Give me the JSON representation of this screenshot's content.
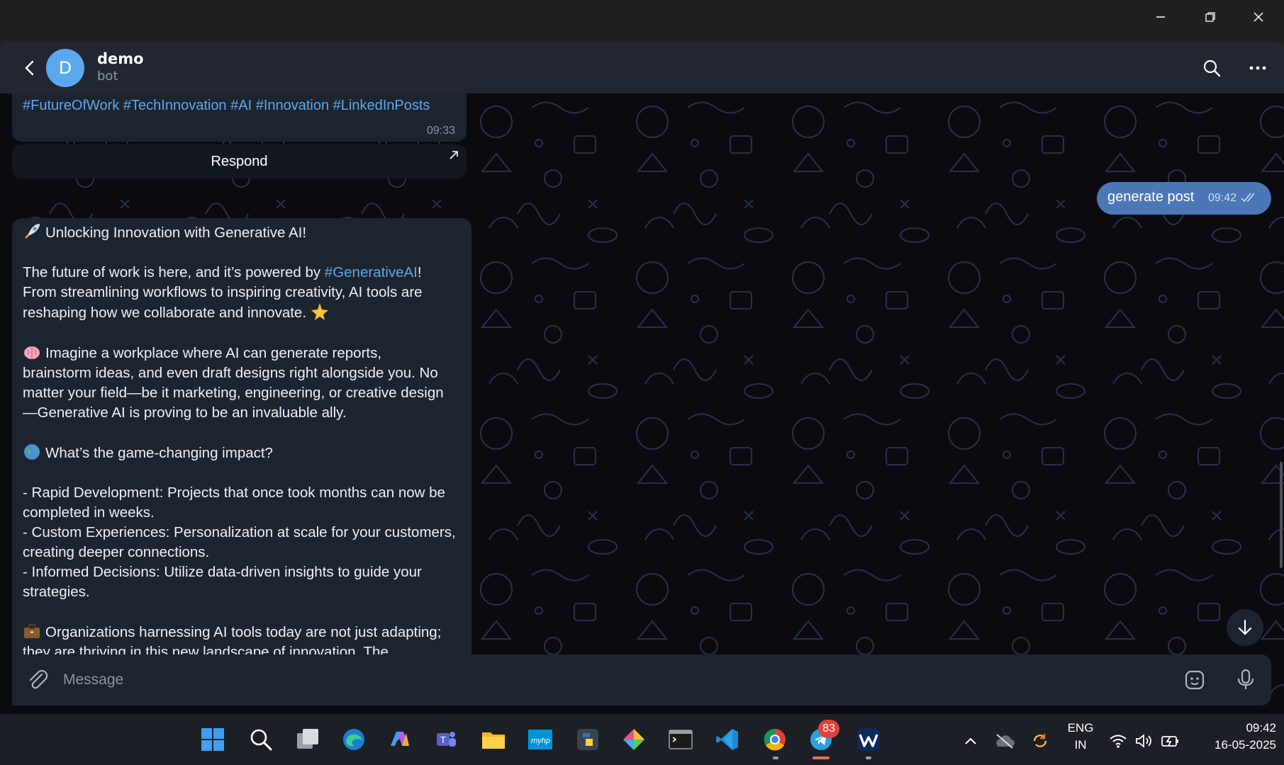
{
  "window": {
    "controls": [
      "minimize-icon",
      "restore-icon",
      "close-icon"
    ]
  },
  "header": {
    "avatar_letter": "D",
    "name": "demo",
    "status": "bot",
    "avatar_color": "#5aa8f0"
  },
  "messages": {
    "previous": {
      "hashtags": "#FutureOfWork #TechInnovation #AI #Innovation #LinkedInPosts",
      "time": "09:33",
      "respond_label": "Respond"
    },
    "outgoing": {
      "text": "generate post",
      "time": "09:42"
    },
    "post": {
      "headline": "Unlocking Innovation with Generative AI!",
      "p1_before": "The future of work is here, and it’s powered by ",
      "p1_link": "#GenerativeAI",
      "p1_after": "!",
      "p1_l2": "From streamlining workflows to inspiring creativity, AI tools are",
      "p1_l3": "reshaping how we collaborate and innovate.",
      "p2_l1": "Imagine a workplace where AI can generate reports,",
      "p2_l2": "brainstorm ideas, and even draft designs right alongside you. No",
      "p2_l3": "matter your field—be it marketing, engineering, or creative design",
      "p2_l4": "—Generative AI is proving to be an invaluable ally.",
      "p3": "What’s the game-changing impact?",
      "b1_l1": "- Rapid Development: Projects that once took months can now be",
      "b1_l2": "completed in weeks.",
      "b2_l1": "- Custom Experiences: Personalization at scale for your customers,",
      "b2_l2": "creating deeper connections.",
      "b3_l1": "- Informed Decisions: Utilize data-driven insights to guide your",
      "b3_l2": "strategies.",
      "p5_l1": "Organizations harnessing AI tools today are not just adapting;",
      "p5_l2": "they are thriving in this new landscape of innovation. The"
    }
  },
  "composer": {
    "placeholder": "Message"
  },
  "taskbar": {
    "telegram_badge": "83",
    "lang_line1": "ENG",
    "lang_line2": "IN",
    "time": "09:42",
    "date": "16-05-2025"
  },
  "colors": {
    "accent": "#4b77b6",
    "link": "#5fa8e8",
    "bubble": "#1c2430"
  }
}
